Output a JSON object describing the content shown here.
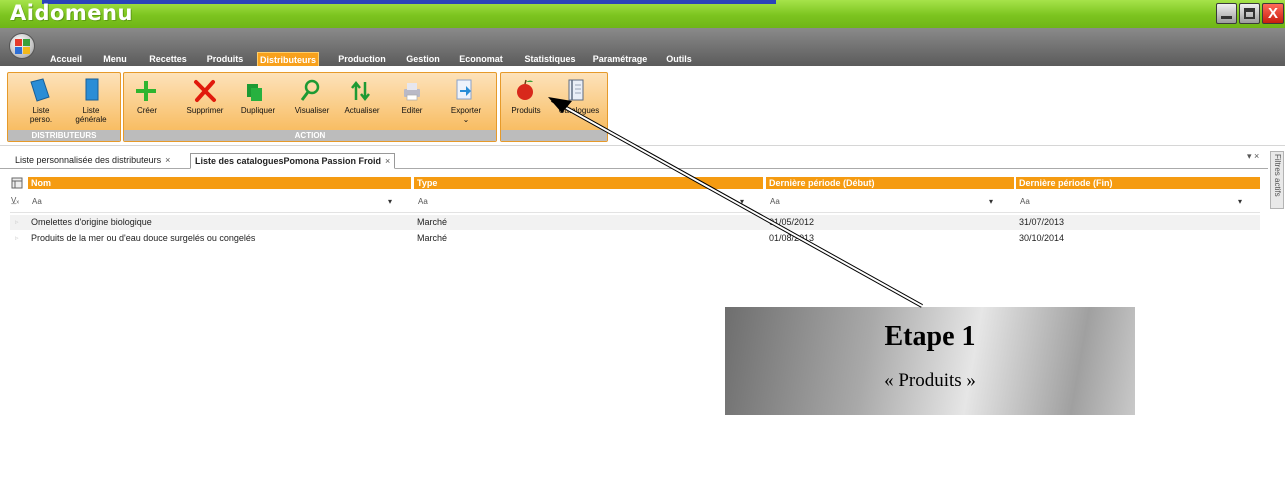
{
  "window": {
    "title": "Aidomenu",
    "minimize_icon": "minimize-icon",
    "maximize_icon": "maximize-icon",
    "close_glyph": "X"
  },
  "menu": {
    "tabs": [
      "Accueil",
      "Menu",
      "Recettes",
      "Produits",
      "Distributeurs",
      "Production",
      "Gestion",
      "Economat",
      "Statistiques",
      "Paramétrage",
      "Outils"
    ],
    "active": "Distributeurs"
  },
  "ribbon": {
    "groups": [
      {
        "label": "DISTRIBUTEURS",
        "buttons": [
          {
            "label": "Liste\nperso.",
            "icon": "book-icon"
          },
          {
            "label": "Liste\ngénérale",
            "icon": "book-icon"
          }
        ]
      },
      {
        "label": "ACTION",
        "buttons": [
          {
            "label": "Créer",
            "icon": "plus-icon"
          },
          {
            "label": "Supprimer",
            "icon": "delete-x-icon"
          },
          {
            "label": "Dupliquer",
            "icon": "duplicate-icon"
          },
          {
            "label": "Visualiser",
            "icon": "magnifier-icon"
          },
          {
            "label": "Actualiser",
            "icon": "refresh-arrows-icon"
          },
          {
            "label": "Editer",
            "icon": "printer-icon"
          },
          {
            "label": "Exporter",
            "icon": "export-arrow-icon"
          }
        ]
      },
      {
        "label": "",
        "buttons": [
          {
            "label": "Produits",
            "icon": "apple-icon"
          },
          {
            "label": "Catalogues",
            "icon": "notebook-icon"
          }
        ]
      }
    ]
  },
  "doc_tabs": [
    {
      "label": "Liste personnalisée des distributeurs",
      "close": "×"
    },
    {
      "label": "Liste des cataloguesPomona Passion Froid",
      "close": "×"
    }
  ],
  "side_panel": {
    "label": "Filtres actifs",
    "controls": "▾ ×"
  },
  "grid": {
    "columns": [
      "Nom",
      "Type",
      "Dernière période (Début)",
      "Dernière période (Fin)"
    ],
    "filter_placeholder": "Aa",
    "rows": [
      [
        "Omelettes d'origine biologique",
        "Marché",
        "01/05/2012",
        "31/07/2013"
      ],
      [
        "Produits de la mer ou d'eau douce surgelés ou congelés",
        "Marché",
        "01/08/2013",
        "30/10/2014"
      ]
    ]
  },
  "callout": {
    "title": "Etape 1",
    "subtitle": "« Produits »"
  },
  "colors": {
    "accent": "#f59b11",
    "titlebar": "#7cc41f",
    "menubar": "#6b6b6b"
  }
}
